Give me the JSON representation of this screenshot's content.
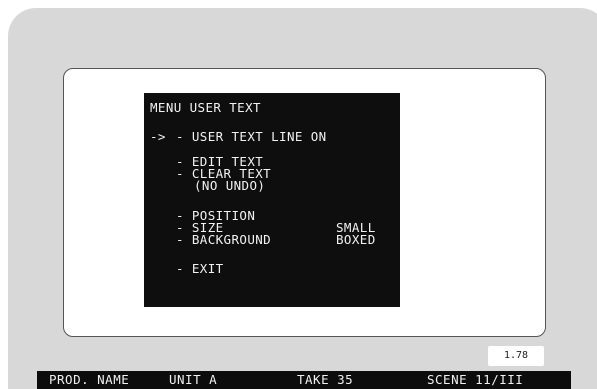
{
  "menu": {
    "title": "MENU USER TEXT",
    "cursor": "->",
    "items": [
      {
        "label": "- USER TEXT LINE ON",
        "value": ""
      },
      {
        "label": "- EDIT TEXT",
        "value": ""
      },
      {
        "label": "- CLEAR TEXT",
        "value": ""
      },
      {
        "label": "(NO UNDO)",
        "value": ""
      },
      {
        "label": "- POSITION",
        "value": ""
      },
      {
        "label": "- SIZE",
        "value": "SMALL"
      },
      {
        "label": "- BACKGROUND",
        "value": "BOXED"
      },
      {
        "label": "- EXIT",
        "value": ""
      }
    ]
  },
  "aspect_ratio": "1.78",
  "status_bar": {
    "prod_name": "PROD. NAME",
    "unit": "UNIT A",
    "take": "TAKE 35",
    "scene": "SCENE 11/III"
  },
  "colors": {
    "menu_background": "#0e0e0e",
    "menu_text": "#f2f2f2",
    "bezel": "#d8d8d8",
    "status_bar": "#0c0c0c"
  }
}
